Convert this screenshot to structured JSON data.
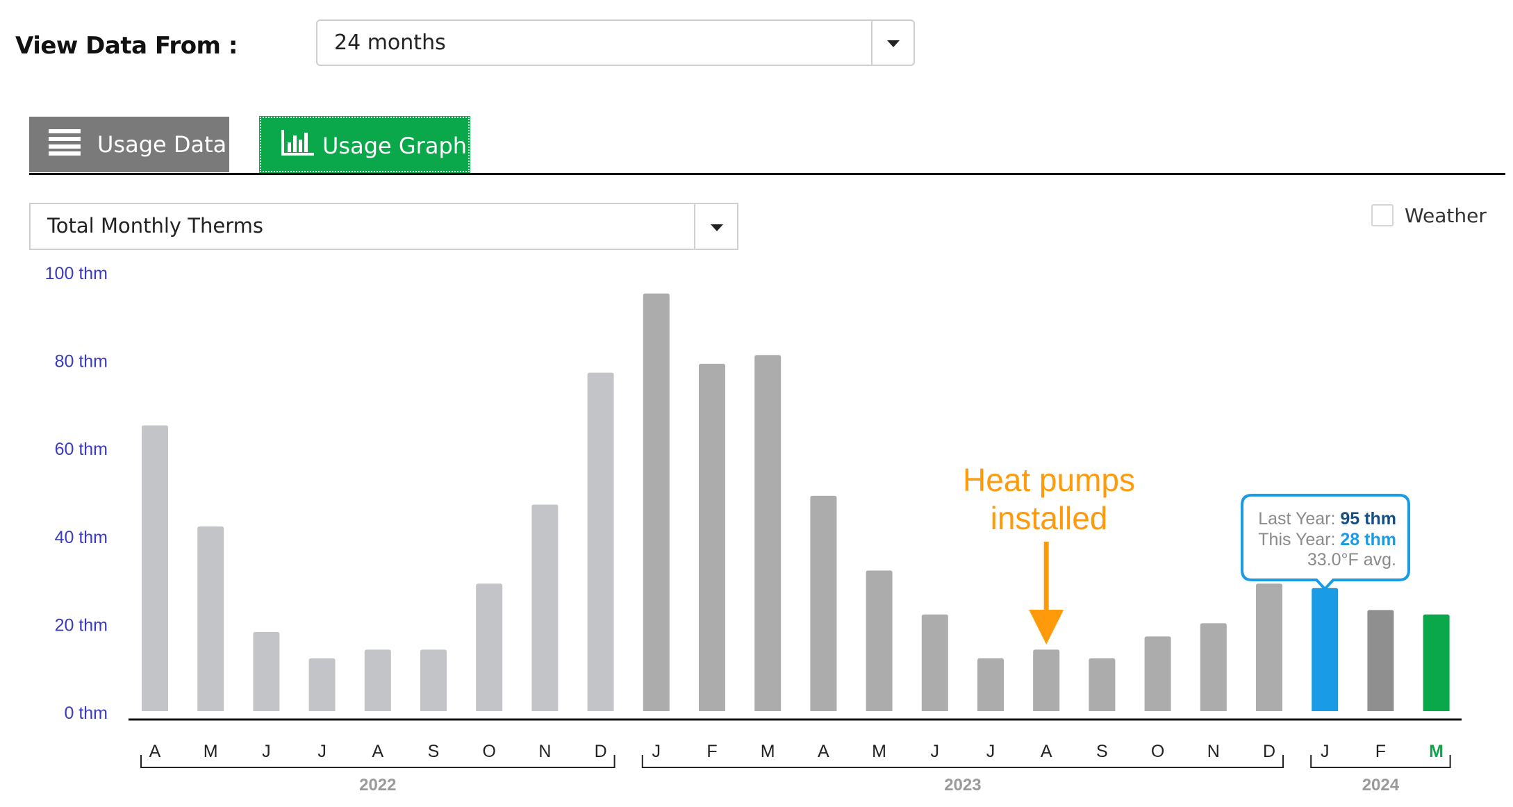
{
  "view_data_from": {
    "label": "View Data From :",
    "selected": "24 months"
  },
  "tabs": [
    {
      "label": "Usage Data",
      "icon": "list-icon",
      "active": false
    },
    {
      "label": "Usage Graph",
      "icon": "bar-chart-icon",
      "active": true
    }
  ],
  "metric_select": {
    "selected": "Total Monthly Therms"
  },
  "weather_toggle": {
    "label": "Weather",
    "checked": false
  },
  "colors": {
    "bar_2022": "#c3c4c7",
    "bar_2023": "#acacac",
    "bar_selected": "#1a9be6",
    "bar_2024_feb": "#8f8f8f",
    "bar_current": "#0aa84a",
    "axis_label": "#3b3bc2",
    "annotation": "#ff9a0a",
    "tab_active": "#0aa84a",
    "tab_inactive": "#7a7a7a"
  },
  "chart_data": {
    "type": "bar",
    "y_unit": "thm",
    "ylim": [
      0,
      100
    ],
    "yticks": [
      "100 thm",
      "80 thm",
      "60 thm",
      "40 thm",
      "20 thm",
      "0 thm"
    ],
    "categories": [
      "A",
      "M",
      "J",
      "J",
      "A",
      "S",
      "O",
      "N",
      "D",
      "J",
      "F",
      "M",
      "A",
      "M",
      "J",
      "J",
      "A",
      "S",
      "O",
      "N",
      "D",
      "J",
      "F",
      "M"
    ],
    "values": [
      65,
      42,
      18,
      12,
      14,
      14,
      29,
      47,
      77,
      95,
      79,
      81,
      49,
      32,
      22,
      12,
      14,
      12,
      17,
      20,
      29,
      28,
      23,
      22
    ],
    "bar_colors": [
      "bar_2022",
      "bar_2022",
      "bar_2022",
      "bar_2022",
      "bar_2022",
      "bar_2022",
      "bar_2022",
      "bar_2022",
      "bar_2022",
      "bar_2023",
      "bar_2023",
      "bar_2023",
      "bar_2023",
      "bar_2023",
      "bar_2023",
      "bar_2023",
      "bar_2023",
      "bar_2023",
      "bar_2023",
      "bar_2023",
      "bar_2023",
      "bar_selected",
      "bar_2024_feb",
      "bar_current"
    ],
    "year_groups": [
      {
        "label": "2022",
        "start": 0,
        "end": 8
      },
      {
        "label": "2023",
        "start": 9,
        "end": 20
      },
      {
        "label": "2024",
        "start": 21,
        "end": 23
      }
    ],
    "highlight_label_index": 23,
    "annotation": {
      "text_line1": "Heat pumps",
      "text_line2": "installed",
      "bar_index": 16
    },
    "tooltip": {
      "bar_index": 21,
      "last_year_label": "Last Year:",
      "last_year_value": "95 thm",
      "this_year_label": "This Year:",
      "this_year_value": "28 thm",
      "weather": "33.0°F avg."
    }
  }
}
